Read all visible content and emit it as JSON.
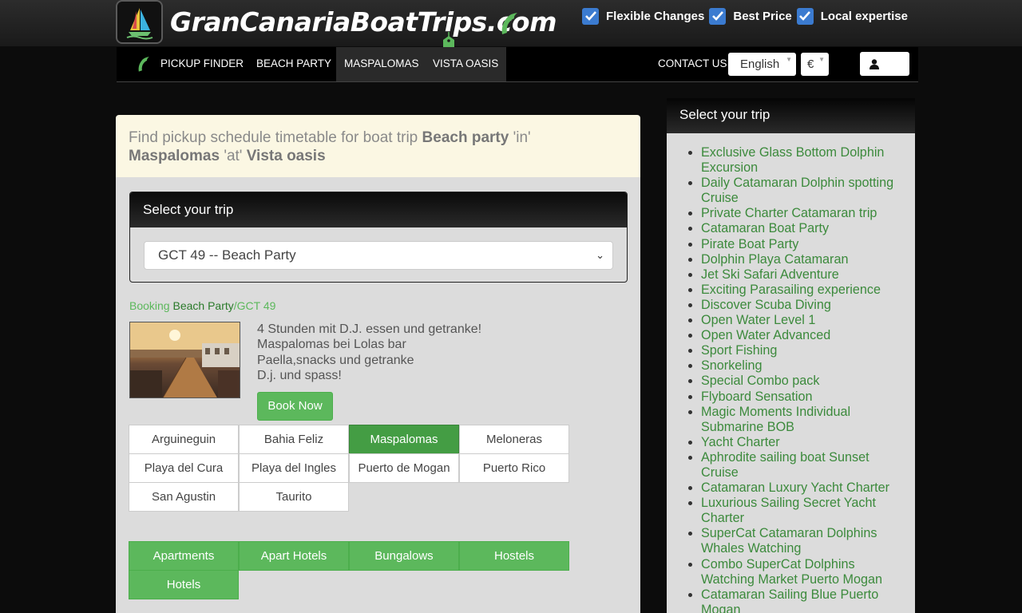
{
  "site": {
    "title": "GranCanariaBoatTrips.com"
  },
  "features": [
    {
      "label": "Flexible Changes"
    },
    {
      "label": "Best Price"
    },
    {
      "label": "Local expertise"
    }
  ],
  "nav": {
    "items": [
      "PICKUP FINDER",
      "BEACH PARTY",
      "MASPALOMAS",
      "VISTA OASIS"
    ],
    "contact": "CONTACT US",
    "language": "English",
    "currency": "€"
  },
  "notice": {
    "prefix": "Find pickup schedule timetable for boat trip ",
    "trip": "Beach party",
    "in": " 'in' ",
    "town": "Maspalomas",
    "at": " 'at' ",
    "hotel": "Vista oasis"
  },
  "trip_select": {
    "heading": "Select your trip",
    "value": "GCT 49 -- Beach Party"
  },
  "breadcrumb": {
    "booking": "Booking ",
    "trip": "Beach Party",
    "code": "/GCT 49"
  },
  "description": [
    "4 Stunden mit D.J. essen und getranke!",
    "Maspalomas bei Lolas bar",
    "Paella,snacks und getranke",
    "D.j. und spass!"
  ],
  "book_button": "Book Now",
  "towns": [
    "Arguineguin",
    "Bahia Feliz",
    "Maspalomas",
    "Meloneras",
    "Playa del Cura",
    "Playa del Ingles",
    "Puerto de Mogan",
    "Puerto Rico",
    "San Agustin",
    "Taurito"
  ],
  "active_town": "Maspalomas",
  "accommodation": [
    "Apartments",
    "Apart Hotels",
    "Bungalows",
    "Hostels",
    "Hotels"
  ],
  "sidebar": {
    "heading": "Select your trip",
    "trips": [
      "Exclusive Glass Bottom Dolphin Excursion",
      "Daily Catamaran Dolphin spotting Cruise",
      "Private Charter Catamaran trip",
      "Catamaran Boat Party",
      "Pirate Boat Party",
      "Dolphin Playa Catamaran",
      "Jet Ski Safari Adventure",
      "Exciting Parasailing experience",
      "Discover Scuba Diving",
      "Open Water Level 1",
      "Open Water Advanced",
      "Sport Fishing",
      "Snorkeling",
      "Special Combo pack",
      "Flyboard Sensation",
      "Magic Moments Individual Submarine BOB",
      "Yacht Charter",
      "Aphrodite sailing boat Sunset Cruise",
      "Catamaran Luxury Yacht Charter",
      "Luxurious Sailing Secret Yacht Charter",
      "SuperCat Catamaran Dolphins Whales Watching",
      "Combo SuperCat Dolphins Watching Market Puerto Mogan",
      "Catamaran Sailing Blue Puerto Mogan"
    ]
  },
  "colors": {
    "accent": "#5cb85c",
    "accent_dark": "#449d44",
    "checkbox": "#3b7bd0",
    "link": "#3c8a3c"
  },
  "icons": {
    "logo": "sailboat-logo-icon",
    "brand": "dolphin-icon",
    "tag": "price-tag-icon",
    "checkbox": "checkmark-icon",
    "user": "user-icon"
  }
}
